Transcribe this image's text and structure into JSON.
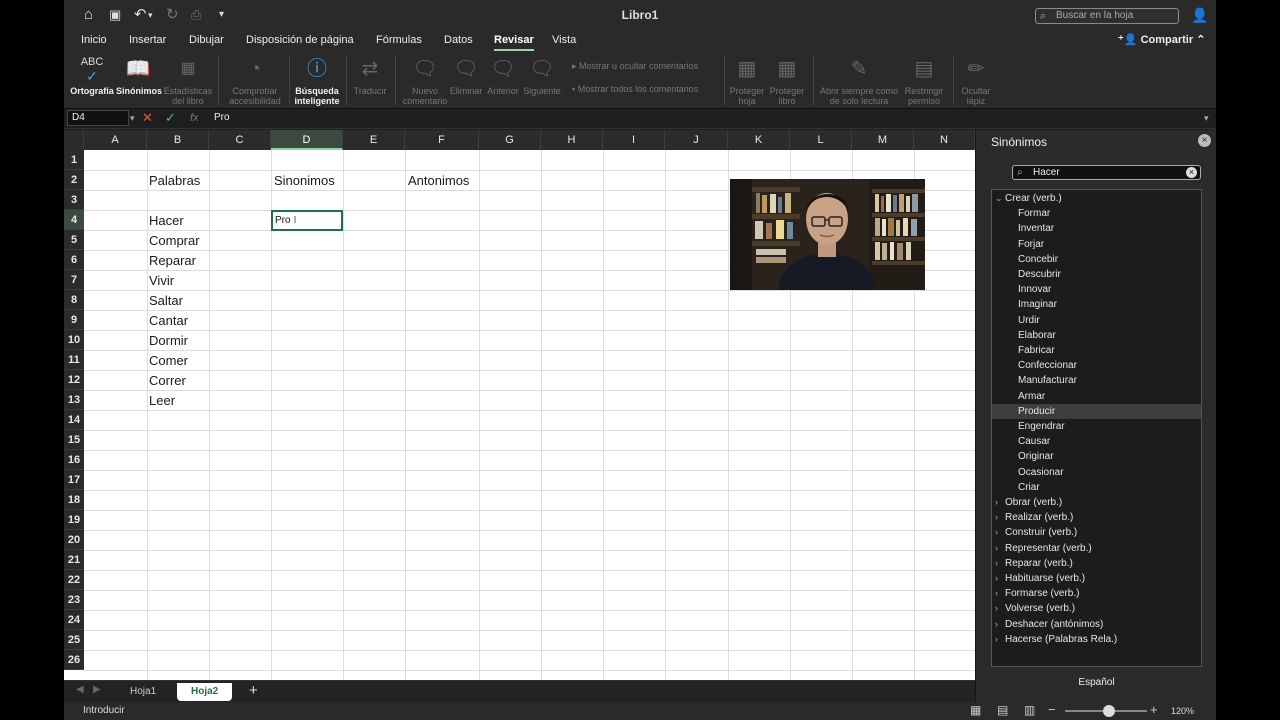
{
  "window": {
    "title": "Libro1",
    "search_placeholder": "Buscar en la hoja"
  },
  "tabs": [
    "Inicio",
    "Insertar",
    "Dibujar",
    "Disposición de página",
    "Fórmulas",
    "Datos",
    "Revisar",
    "Vista"
  ],
  "active_tab": "Revisar",
  "share_label": "Compartir",
  "ribbon": {
    "ortografia": "Ortografía",
    "sinonimos": "Sinónimos",
    "estadisticas_1": "Estadísticas",
    "estadisticas_2": "del libro",
    "comprobar_1": "Comprobar",
    "comprobar_2": "accesibilidad",
    "busqueda_1": "Búsqueda",
    "busqueda_2": "inteligente",
    "traducir": "Traducir",
    "nuevo_1": "Nuevo",
    "nuevo_2": "comentario",
    "eliminar": "Eliminar",
    "anterior": "Anterior",
    "siguiente": "Siguiente",
    "mostrar_ocultar": "Mostrar u ocultar comentarios",
    "mostrar_todos": "Mostrar todos los comentarios",
    "proteger_hoja_1": "Proteger",
    "proteger_hoja_2": "hoja",
    "proteger_libro_1": "Proteger",
    "proteger_libro_2": "libro",
    "abrir_1": "Abrir siempre como",
    "abrir_2": "de solo lectura",
    "restringir_1": "Restringir",
    "restringir_2": "permiso",
    "ocultar_1": "Ocultar",
    "ocultar_2": "lápiz",
    "abc": "ABC"
  },
  "formula_bar": {
    "name_box": "D4",
    "fx": "fx",
    "content": "Pro"
  },
  "sheet": {
    "columns": [
      "A",
      "B",
      "C",
      "D",
      "E",
      "F",
      "G",
      "H",
      "I",
      "J",
      "K",
      "L",
      "M",
      "N"
    ],
    "selected_column": "D",
    "rows": [
      "1",
      "2",
      "3",
      "4",
      "5",
      "6",
      "7",
      "8",
      "9",
      "10",
      "11",
      "12",
      "13",
      "14",
      "15",
      "16",
      "17",
      "18",
      "19",
      "20",
      "21",
      "22",
      "23",
      "24",
      "25",
      "26"
    ],
    "selected_row": "4",
    "headers": {
      "palabras": "Palabras",
      "sinonimos": "Sinonimos",
      "antonimos": "Antonimos"
    },
    "words": [
      "Hacer",
      "Comprar",
      "Reparar",
      "Vivir",
      "Saltar",
      "Cantar",
      "Dormir",
      "Comer",
      "Correr",
      "Leer"
    ],
    "active_cell_text": "Pro"
  },
  "sheet_tabs": [
    "Hoja1",
    "Hoja2"
  ],
  "active_sheet": "Hoja2",
  "status": {
    "mode": "Introducir",
    "zoom": "120%"
  },
  "panel": {
    "title": "Sinónimos",
    "search_value": "Hacer",
    "expanded_group": "Crear (verb.)",
    "synonyms": [
      "Formar",
      "Inventar",
      "Forjar",
      "Concebir",
      "Descubrir",
      "Innovar",
      "Imaginar",
      "Urdir",
      "Elaborar",
      "Fabricar",
      "Confeccionar",
      "Manufacturar",
      "Armar",
      "Producir",
      "Engendrar",
      "Causar",
      "Originar",
      "Ocasionar",
      "Criar"
    ],
    "highlighted": "Producir",
    "collapsed_groups": [
      "Obrar (verb.)",
      "Realizar (verb.)",
      "Construir (verb.)",
      "Representar (verb.)",
      "Reparar (verb.)",
      "Habituarse (verb.)",
      "Formarse (verb.)",
      "Volverse (verb.)",
      "Deshacer (antónimos)",
      "Hacerse (Palabras Rela.)"
    ],
    "language": "Español"
  },
  "colors": {
    "accent": "#1e7145",
    "panel_bg": "#2b2b2b",
    "header_bg": "#2b2b2b"
  }
}
